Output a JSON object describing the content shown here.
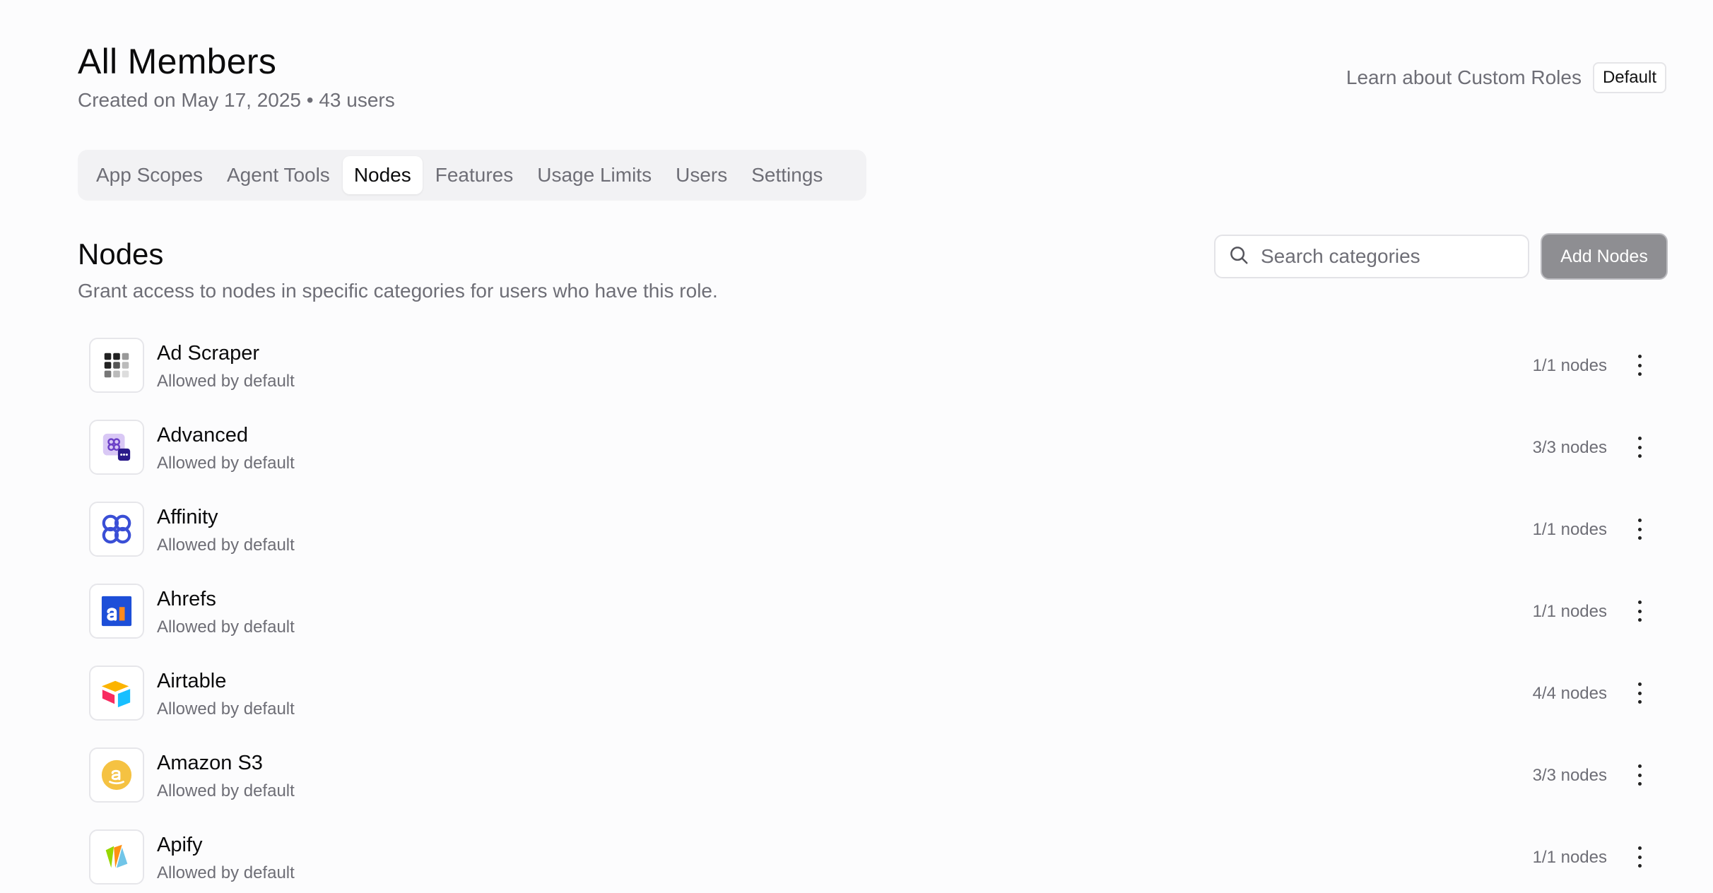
{
  "header": {
    "title": "All Members",
    "subtitle": "Created on May 17, 2025 • 43 users",
    "learn_link": "Learn about Custom Roles",
    "badge": "Default"
  },
  "tabs": [
    {
      "label": "App Scopes",
      "active": false
    },
    {
      "label": "Agent Tools",
      "active": false
    },
    {
      "label": "Nodes",
      "active": true
    },
    {
      "label": "Features",
      "active": false
    },
    {
      "label": "Usage Limits",
      "active": false
    },
    {
      "label": "Users",
      "active": false
    },
    {
      "label": "Settings",
      "active": false
    }
  ],
  "section": {
    "title": "Nodes",
    "description": "Grant access to nodes in specific categories for users who have this role.",
    "search_placeholder": "Search categories",
    "add_button": "Add Nodes"
  },
  "nodes": [
    {
      "name": "Ad Scraper",
      "status": "Allowed by default",
      "count": "1/1 nodes",
      "icon": "ad-scraper-icon"
    },
    {
      "name": "Advanced",
      "status": "Allowed by default",
      "count": "3/3 nodes",
      "icon": "advanced-icon"
    },
    {
      "name": "Affinity",
      "status": "Allowed by default",
      "count": "1/1 nodes",
      "icon": "affinity-icon"
    },
    {
      "name": "Ahrefs",
      "status": "Allowed by default",
      "count": "1/1 nodes",
      "icon": "ahrefs-icon"
    },
    {
      "name": "Airtable",
      "status": "Allowed by default",
      "count": "4/4 nodes",
      "icon": "airtable-icon"
    },
    {
      "name": "Amazon S3",
      "status": "Allowed by default",
      "count": "3/3 nodes",
      "icon": "amazon-s3-icon"
    },
    {
      "name": "Apify",
      "status": "Allowed by default",
      "count": "1/1 nodes",
      "icon": "apify-icon"
    }
  ],
  "colors": {
    "background": "#fcfcfd",
    "muted_text": "#6e6e76",
    "add_button_bg": "#8e8e92"
  }
}
